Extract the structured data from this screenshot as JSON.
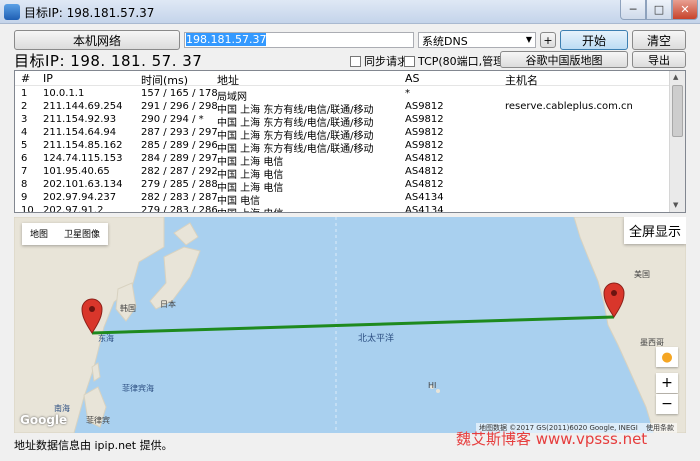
{
  "window": {
    "title": "目标IP: 198.181.57.37"
  },
  "toolbar": {
    "local_network_label": "本机网络",
    "ip_value": "198.181.57.37",
    "dns_selected": "系统DNS",
    "plus_label": "+",
    "start_label": "开始",
    "clear_label": "清空",
    "china_map_label": "谷歌中国版地图",
    "export_label": "导出",
    "target_label": "目标IP:  198. 181. 57. 37",
    "sync_request_label": "同步请求",
    "tcp_label": "TCP(80端口,管理员)"
  },
  "table": {
    "headers": [
      "#",
      "IP",
      "时间(ms)",
      "地址",
      "AS",
      "主机名"
    ],
    "rows": [
      [
        "1",
        "10.0.1.1",
        "157 / 165 / 178",
        "局域网",
        "*",
        ""
      ],
      [
        "2",
        "211.144.69.254",
        "291 / 296 / 298",
        "中国 上海 东方有线/电信/联通/移动",
        "AS9812",
        "reserve.cableplus.com.cn"
      ],
      [
        "3",
        "211.154.92.93",
        "290 / 294 / *",
        "中国 上海 东方有线/电信/联通/移动",
        "AS9812",
        ""
      ],
      [
        "4",
        "211.154.64.94",
        "287 / 293 / 297",
        "中国 上海 东方有线/电信/联通/移动",
        "AS9812",
        ""
      ],
      [
        "5",
        "211.154.85.162",
        "285 / 289 / 296",
        "中国 上海 东方有线/电信/联通/移动",
        "AS9812",
        ""
      ],
      [
        "6",
        "124.74.115.153",
        "284 / 289 / 297",
        "中国 上海 电信",
        "AS4812",
        ""
      ],
      [
        "7",
        "101.95.40.65",
        "282 / 287 / 292",
        "中国 上海 电信",
        "AS4812",
        ""
      ],
      [
        "8",
        "202.101.63.134",
        "279 / 285 / 288",
        "中国 上海 电信",
        "AS4812",
        ""
      ],
      [
        "9",
        "202.97.94.237",
        "282 / 283 / 287",
        "中国 电信",
        "AS4134",
        ""
      ],
      [
        "10",
        "202.97.91.2",
        "279 / 283 / 286",
        "中国 上海 电信",
        "AS4134",
        ""
      ]
    ]
  },
  "map": {
    "type_map": "地图",
    "type_satellite": "卫星图像",
    "fullscreen_label": "全屏显示",
    "zoom_in": "+",
    "zoom_out": "−",
    "logo": "Google",
    "footer_text": "地图数据 ©2017 GS(2011)6020 Google, INEGI",
    "terms": "使用条款",
    "labels": {
      "korea": "韩国",
      "japan": "日本",
      "pacific": "北太平洋",
      "philippines": "菲律宾",
      "philippine_sea": "菲律宾海",
      "hawaii": "HI",
      "east_sea": "东海",
      "north_pacific_left": "北太平洋",
      "south_china_sea": "南海",
      "mexico": "墨西哥",
      "usa": "美国"
    },
    "route_color": "#1e8a1e",
    "pin_color": "#d9362b",
    "water_color": "#a9d0ef"
  },
  "status_text": "地址数据信息由 ipip.net 提供。",
  "watermark": "魏艾斯博客 www.vpsss.net"
}
